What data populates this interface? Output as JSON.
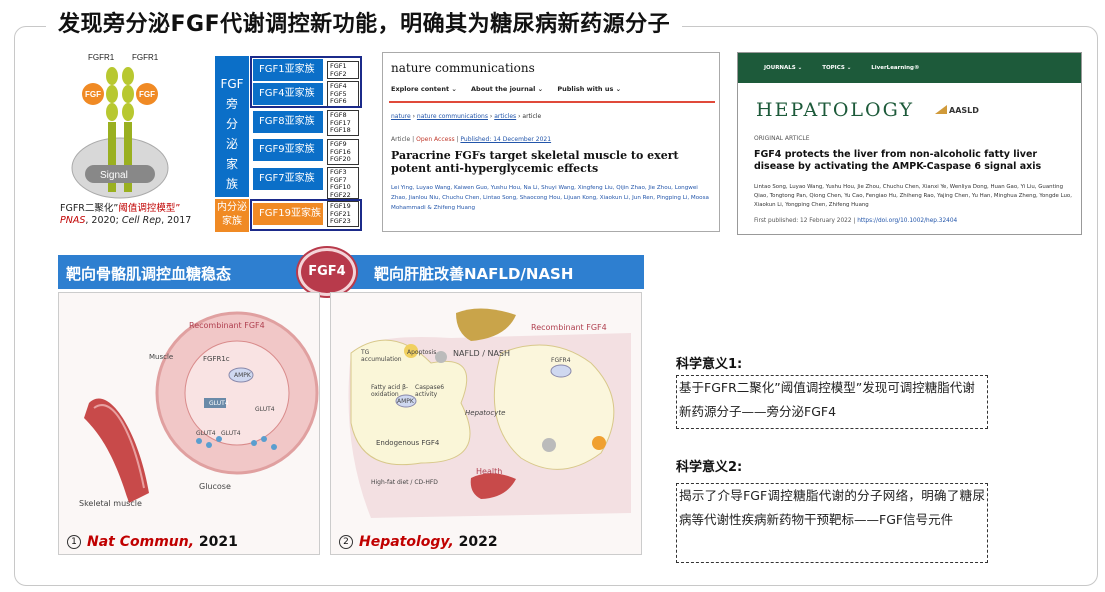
{
  "title": "发现旁分泌FGF代谢调控新功能，明确其为糖尿病新药源分子",
  "receptor": {
    "label_fgfr_left": "FGFR1",
    "label_fgfr_right": "FGFR1",
    "label_fgf_left": "FGF",
    "label_fgf_right": "FGF",
    "label_signal": "Signal",
    "caption_prefix": "FGFR二聚化”",
    "caption_red": "阈值调控模型”",
    "ref_pnas": "PNAS",
    "ref_mid": ", 2020; ",
    "ref_cell": "Cell Rep",
    "ref_end": ", 2017"
  },
  "family": {
    "side_label": [
      "FGF",
      "旁",
      "分",
      "泌",
      "家",
      "族"
    ],
    "side_label2": "内分泌家族",
    "rows": [
      {
        "name": "FGF1亚家族",
        "members": "FGF1\nFGF2"
      },
      {
        "name": "FGF4亚家族",
        "members": "FGF4\nFGF5\nFGF6"
      },
      {
        "name": "FGF8亚家族",
        "members": "FGF8\nFGF17\nFGF18"
      },
      {
        "name": "FGF9亚家族",
        "members": "FGF9\nFGF16\nFGF20"
      },
      {
        "name": "FGF7亚家族",
        "members": "FGF3\nFGF7\nFGF10\nFGF22"
      },
      {
        "name": "FGF19亚家族",
        "members": "FGF19\nFGF21\nFGF23"
      }
    ]
  },
  "nc_article": {
    "brand": "nature communications",
    "nav": [
      "Explore content ⌄",
      "About the journal ⌄",
      "Publish with us ⌄"
    ],
    "crumb_1": "nature",
    "crumb_2": "nature communications",
    "crumb_3": "articles",
    "crumb_4": "article",
    "meta_type": "Article",
    "meta_oa": "Open Access",
    "meta_pub": "Published: 14 December 2021",
    "title": "Paracrine FGFs target skeletal muscle to exert potent anti-hyperglycemic effects",
    "authors": "Lei Ying, Luyao Wang, Kaiwen Guo, Yushu Hou, Na Li, Shuyi Wang, Xingfeng Liu, Qijin Zhao, Jie Zhou, Longwei Zhao, Jianlou Niu, Chuchu Chen, Lintao Song, Shaocong Hou, Lijuan Kong, Xiaokun Li, Jun Ren, Pingping Li, Moosa Mohammadi & Zhifeng Huang"
  },
  "hep_article": {
    "nav": [
      "JOURNALS ⌄",
      "TOPICS ⌄",
      "LiverLearning®"
    ],
    "logo": "HEPATOLOGY",
    "aasld": "AASLD",
    "type": "ORIGINAL ARTICLE",
    "title": "FGF4 protects the liver from non-alcoholic fatty liver disease by activating the AMPK-Caspase 6 signal axis",
    "authors": "Lintao Song, Luyao Wang, Yushu Hou, Jie Zhou, Chuchu Chen, Xianxi Ye, Wenliya Dong, Huan Gao, Yi Liu, Guanting Qiao, Tongtong Pan, Qiong Chen, Yu Cao, Fengiao Hu, Zhiheng Rao, Yajing Chen, Yu Han, Minghua Zheng, Yongde Luo, Xiaokun Li, Yongping Chen, Zhifeng Huang",
    "pub_prefix": "First published: 12 February 2022",
    "doi": "https://doi.org/10.1002/hep.32404"
  },
  "banner": {
    "left": "靶向骨骼肌调控血糖稳态",
    "badge": "FGF4",
    "right": "靶向肝脏改善NAFLD/NASH"
  },
  "panel1": {
    "recombinant": "Recombinant FGF4",
    "muscle": "Muscle",
    "fgfr": "FGFR1c",
    "ampk": "AMPK",
    "glut4_a": "GLUT4",
    "glut4_b": "GLUT4",
    "glut4_c": "GLUT4",
    "glut4_d": "GLUT4",
    "glucose": "Glucose",
    "skeletal": "Skeletal muscle",
    "cite_num": "1",
    "cite_journal": "Nat Commun,",
    "cite_year": " 2021"
  },
  "panel2": {
    "recombinant": "Recombinant FGF4",
    "nafld": "NAFLD / NASH",
    "tg_acc": "TG accumulation",
    "apoptosis": "Apoptosis",
    "fao": "Fatty acid β-oxidation",
    "casp6": "Caspase6 activity",
    "ampk": "AMPK",
    "endogenous": "Endogenous FGF4",
    "hepatocyte": "Hepatocyte",
    "health": "Health",
    "diet": "High-fat diet / CD-HFD",
    "fgfr4": "FGFR4",
    "cite_num": "2",
    "cite_journal": "Hepatology,",
    "cite_year": " 2022"
  },
  "significance": {
    "h1": "科学意义1:",
    "t1": "基于FGFR二聚化”阈值调控模型”发现可调控糖脂代谢新药源分子——旁分泌FGF4",
    "h2": "科学意义2:",
    "t2": "揭示了介导FGF调控糖脂代谢的分子网络，明确了糖尿病等代谢性疾病新药物干预靶标——FGF信号元件"
  }
}
